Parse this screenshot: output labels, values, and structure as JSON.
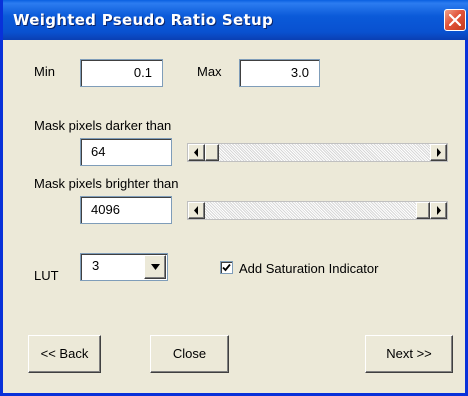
{
  "window": {
    "title": "Weighted Pseudo Ratio Setup",
    "colors": {
      "titlebar": "#0a5fe0",
      "close": "#e2543a",
      "face": "#ece9d8"
    }
  },
  "range": {
    "min_label": "Min",
    "min_value": "0.1",
    "max_label": "Max",
    "max_value": "3.0"
  },
  "darker": {
    "label": "Mask pixels darker than",
    "value": "64",
    "slider_level": 0.0
  },
  "brighter": {
    "label": "Mask pixels brighter than",
    "value": "4096",
    "slider_level": 1.0
  },
  "lut": {
    "label": "LUT",
    "selected": "3"
  },
  "saturation": {
    "label": "Add Saturation Indicator",
    "checked": true
  },
  "buttons": {
    "back": "<< Back",
    "close": "Close",
    "next": "Next >>"
  },
  "icons": [
    "close-icon",
    "scroll-left-icon",
    "scroll-right-icon",
    "dropdown-arrow-icon",
    "checkmark-icon"
  ]
}
